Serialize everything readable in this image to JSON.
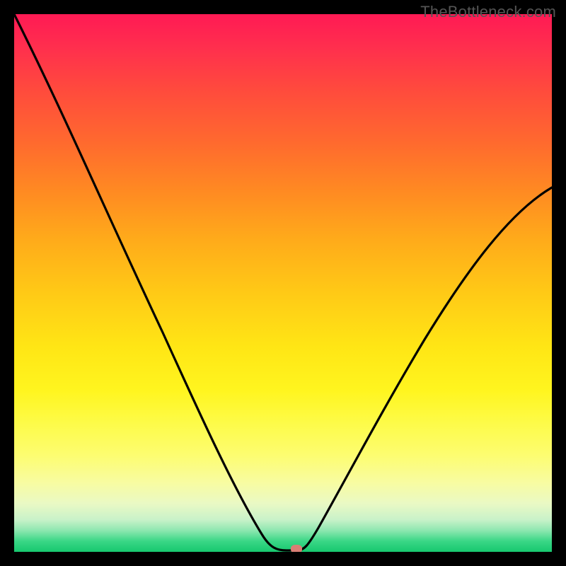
{
  "watermark": "TheBottleneck.com",
  "chart_data": {
    "type": "line",
    "title": "",
    "xlabel": "",
    "ylabel": "",
    "x": [
      0.0,
      0.05,
      0.1,
      0.15,
      0.2,
      0.25,
      0.3,
      0.35,
      0.4,
      0.45,
      0.48,
      0.5,
      0.52,
      0.55,
      0.58,
      0.6,
      0.65,
      0.7,
      0.75,
      0.8,
      0.85,
      0.9,
      0.95,
      1.0
    ],
    "values": [
      1.0,
      0.89,
      0.78,
      0.67,
      0.56,
      0.45,
      0.34,
      0.23,
      0.12,
      0.04,
      0.01,
      0.0,
      0.0,
      0.01,
      0.03,
      0.06,
      0.14,
      0.22,
      0.3,
      0.37,
      0.44,
      0.5,
      0.56,
      0.62
    ],
    "xlim": [
      0,
      1
    ],
    "ylim": [
      0,
      1
    ],
    "marker": {
      "x": 0.52,
      "y": 0.0
    },
    "background": "red-yellow-green vertical gradient",
    "grid": false,
    "axes_visible": false
  }
}
